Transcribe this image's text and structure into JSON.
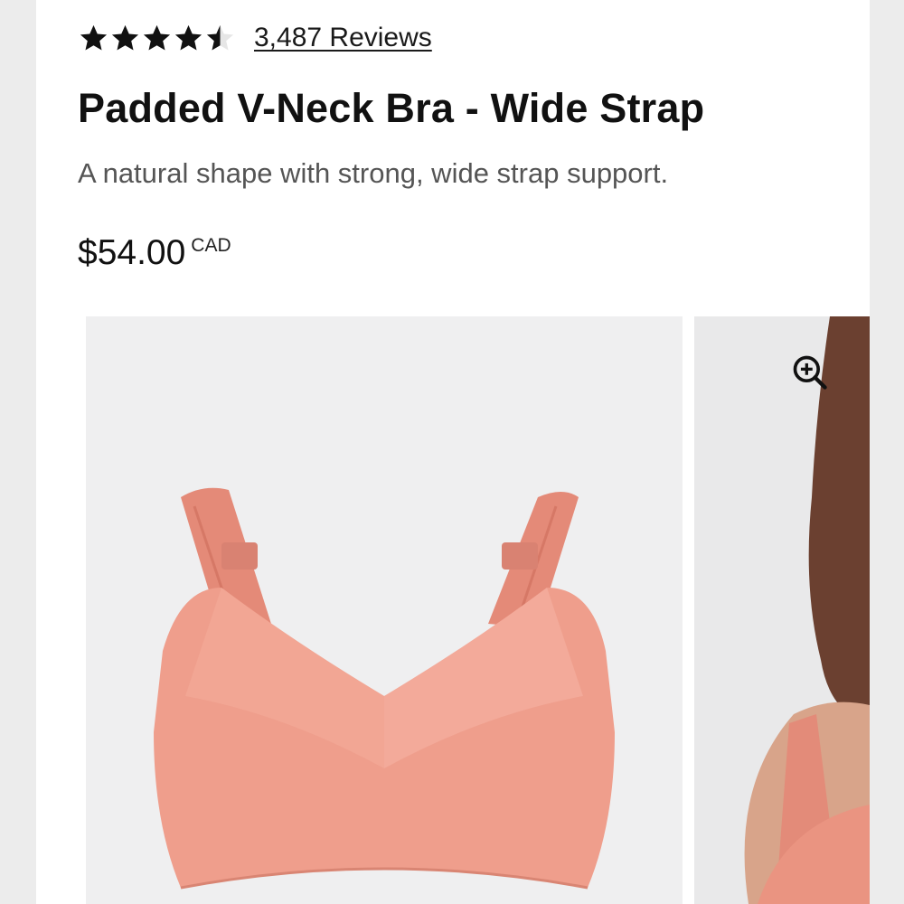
{
  "rating": {
    "value": 4.5,
    "max": 5,
    "reviews_label": "3,487 Reviews"
  },
  "product": {
    "title": "Padded V-Neck Bra - Wide Strap",
    "subtitle": "A natural shape with strong, wide strap support.",
    "price": "$54.00",
    "currency": "CAD"
  },
  "gallery": {
    "main_image_icon": "bra-product-image",
    "second_image_icon": "model-photo",
    "zoom_icon": "zoom-in-icon"
  },
  "colors": {
    "product_color": "#ec9b87",
    "image_bg": "#efeff0",
    "text_primary": "#111111",
    "text_secondary": "#555555"
  }
}
